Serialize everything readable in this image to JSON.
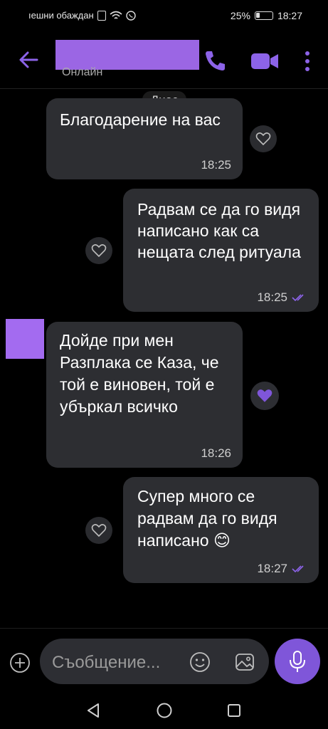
{
  "status_bar": {
    "carrier_text": "ıешни обаждан",
    "battery": "25%",
    "time": "18:27"
  },
  "header": {
    "status": "Онлайн"
  },
  "date_chip": "Днес",
  "messages": [
    {
      "direction": "incoming",
      "text": "Благодарение на вас",
      "time": "18:25",
      "liked": false
    },
    {
      "direction": "outgoing",
      "text": "Радвам се да го видя написано как са нещата след ритуала",
      "time": "18:25",
      "liked": false
    },
    {
      "direction": "incoming",
      "text": "Дойде при мен Разплака се Каза, че той е виновен, той е убъркал всичко",
      "time": "18:26",
      "liked": true
    },
    {
      "direction": "outgoing",
      "text": "Супер много се радвам да го видя написано 😊",
      "time": "18:27",
      "liked": false
    }
  ],
  "composer": {
    "placeholder": "Съобщение..."
  },
  "colors": {
    "accent": "#7f56d9",
    "bubble": "#2d2e32",
    "redaction": "#a36bf0"
  }
}
